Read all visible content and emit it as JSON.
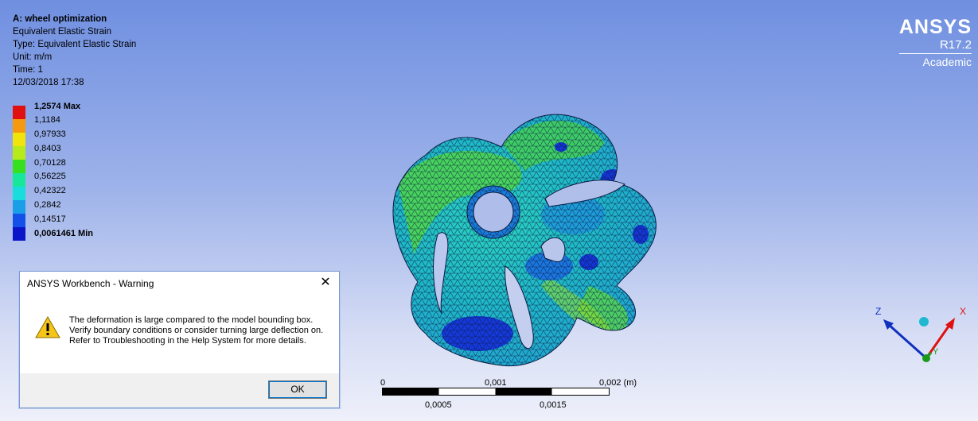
{
  "header": {
    "title": "A: wheel optimization",
    "result": "Equivalent Elastic Strain",
    "type": "Type: Equivalent Elastic Strain",
    "unit": "Unit: m/m",
    "time": "Time: 1",
    "date": "12/03/2018 17:38"
  },
  "legend": {
    "items": [
      {
        "label": "1,2574 Max",
        "color": "#e01010"
      },
      {
        "label": "1,1184",
        "color": "#f59a10"
      },
      {
        "label": "0,97933",
        "color": "#f1e40a"
      },
      {
        "label": "0,8403",
        "color": "#b7ea1a"
      },
      {
        "label": "0,70128",
        "color": "#36e01e"
      },
      {
        "label": "0,56225",
        "color": "#18e69a"
      },
      {
        "label": "0,42322",
        "color": "#19dcdc"
      },
      {
        "label": "0,2842",
        "color": "#1b9ee8"
      },
      {
        "label": "0,14517",
        "color": "#1350e8"
      },
      {
        "label": "0,0061461 Min",
        "color": "#0a14c8"
      }
    ]
  },
  "brand": {
    "name": "ANSYS",
    "version": "R17.2",
    "edition": "Academic"
  },
  "scale": {
    "top_labels": [
      "0",
      "0,001",
      "0,002 (m)"
    ],
    "bottom_labels": [
      "0,0005",
      "0,0015"
    ]
  },
  "triad": {
    "x": "X",
    "y": "Y",
    "z": "Z",
    "colors": {
      "x": "#e01010",
      "y": "#1a9a1a",
      "z": "#1030c0",
      "iso": "#20b8d0"
    }
  },
  "dialog": {
    "title": "ANSYS Workbench - Warning",
    "message": "The deformation is large compared to the model bounding box.  Verify boundary conditions or consider turning large deflection on.  Refer to Troubleshooting in the Help System for more details.",
    "ok_label": "OK",
    "close_glyph": "✕"
  }
}
